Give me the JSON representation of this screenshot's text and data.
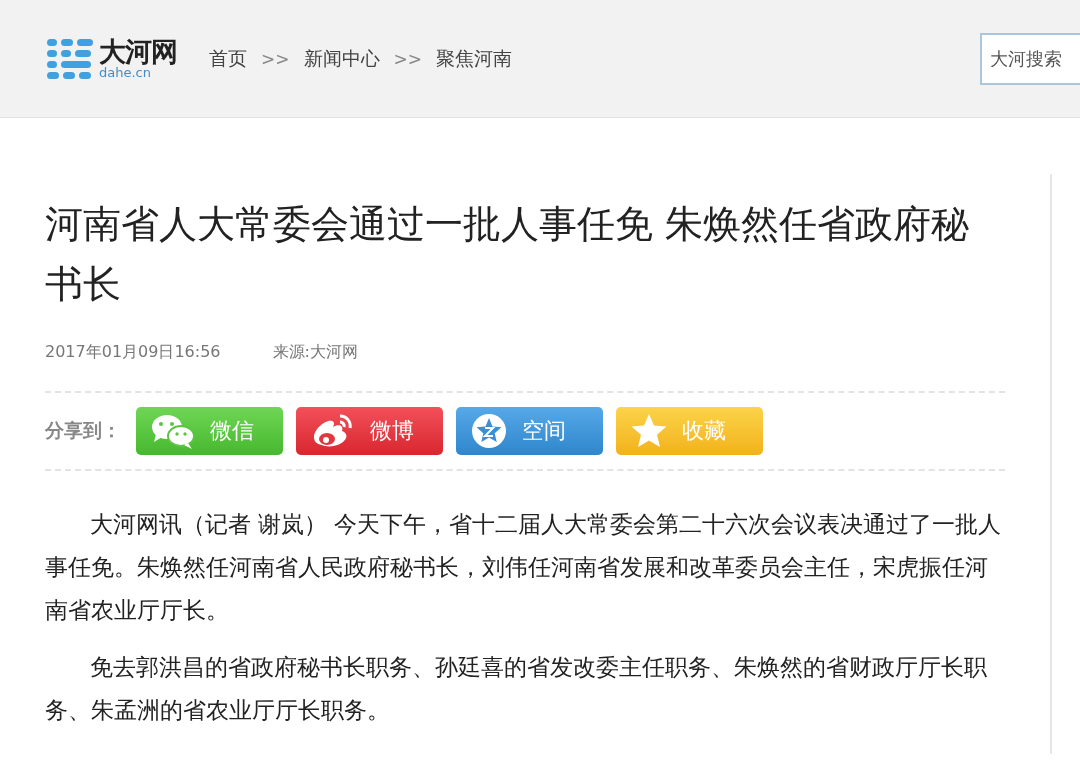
{
  "header": {
    "logo": {
      "name": "大河网",
      "domain": "dahe.cn"
    },
    "breadcrumbs": [
      {
        "kind": "link",
        "text": "首页"
      },
      {
        "kind": "separator",
        "text": ">>"
      },
      {
        "kind": "link",
        "text": "新闻中心"
      },
      {
        "kind": "separator",
        "text": ">>"
      },
      {
        "kind": "link",
        "text": "聚焦河南"
      }
    ],
    "search": {
      "placeholder": "大河搜索"
    }
  },
  "article": {
    "title": "河南省人大常委会通过一批人事任免 朱焕然任省政府秘书长",
    "date": "2017年01月09日16:56",
    "source": "来源:大河网",
    "share": {
      "label": "分享到：",
      "buttons": [
        {
          "kind": "wechat",
          "label": "微信"
        },
        {
          "kind": "weibo",
          "label": "微博"
        },
        {
          "kind": "qzone",
          "label": "空间"
        },
        {
          "kind": "favorite",
          "label": "收藏"
        }
      ]
    },
    "paragraphs": [
      "大河网讯（记者 谢岚） 今天下午，省十二届人大常委会第二十六次会议表决通过了一批人事任免。朱焕然任河南省人民政府秘书长，刘伟任河南省发展和改革委员会主任，宋虎振任河南省农业厅厅长。",
      "免去郭洪昌的省政府秘书长职务、孙廷喜的省发改委主任职务、朱焕然的省财政厅厅长职务、朱孟洲的省农业厅厅长职务。"
    ]
  }
}
